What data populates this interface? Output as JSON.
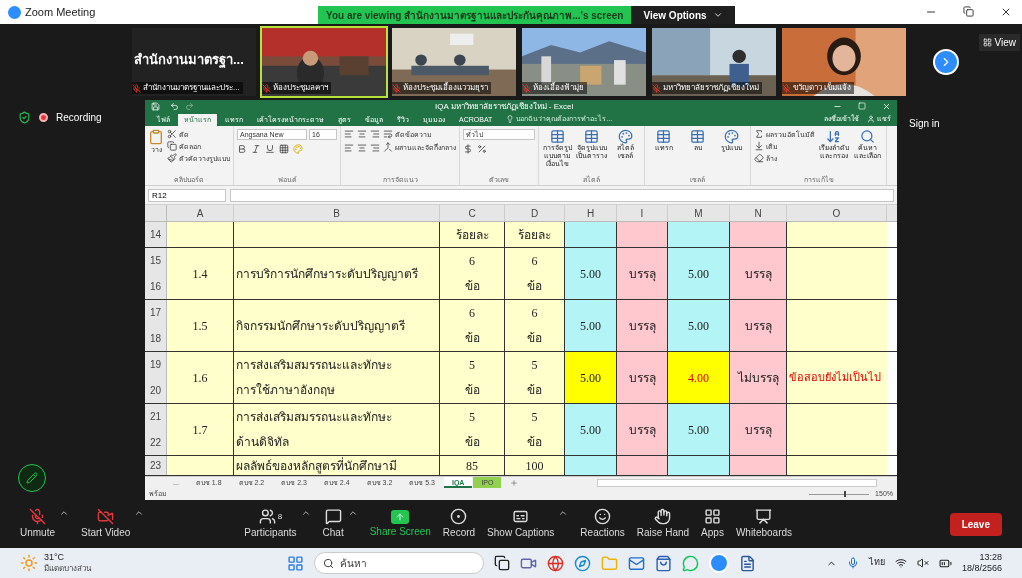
{
  "window": {
    "title": "Zoom Meeting"
  },
  "share_banner": {
    "text": "You are viewing สำนักงานมาตรฐานและประกันคุณภาพ...'s screen",
    "button": "View Options"
  },
  "view_button": "View",
  "recording": "Recording",
  "sign_in": "Sign in",
  "video_tiles": [
    {
      "kind": "text",
      "caption": "สำนักงานมาตรฐา...",
      "name": "สำนักงานมาตรฐานและประ...",
      "muted": true,
      "selected": false
    },
    {
      "kind": "picture",
      "name": "ห้องประชุมลคาฯ",
      "muted": true,
      "selected": true
    },
    {
      "kind": "picture",
      "name": "ห้องประชุมเอื้องแววมยุรา",
      "muted": true,
      "selected": false
    },
    {
      "kind": "picture",
      "name": "ห้องเอื้องฟ้ามุ่ย",
      "muted": true,
      "selected": false
    },
    {
      "kind": "picture",
      "name": "มหาวิทยาลัยราชภัฏเชียงใหม่",
      "muted": true,
      "selected": false
    },
    {
      "kind": "picture",
      "name": "ขวัญดาว เข็มแจ้ง",
      "muted": true,
      "selected": false
    }
  ],
  "excel": {
    "title": "IQA มหาวิทยาลัยราชภัฏเชียงใหม่ - Excel",
    "tabs": [
      {
        "label": "ไฟล์",
        "selected": false
      },
      {
        "label": "หน้าแรก",
        "selected": true
      },
      {
        "label": "แทรก",
        "selected": false
      },
      {
        "label": "เค้าโครงหน้ากระดาษ",
        "selected": false
      },
      {
        "label": "สูตร",
        "selected": false
      },
      {
        "label": "ข้อมูล",
        "selected": false
      },
      {
        "label": "รีวิว",
        "selected": false
      },
      {
        "label": "มุมมอง",
        "selected": false
      },
      {
        "label": "ACROBAT",
        "selected": false
      }
    ],
    "tell_me": "บอกฉันว่าคุณต้องการทำอะไร...",
    "sign_in": "ลงชื่อเข้าใช้",
    "share": "แชร์",
    "ribbon": [
      {
        "kind": "clipboard",
        "label": "คลิปบอร์ด",
        "big": "วาง",
        "small": [
          "ตัด",
          "คัดลอก",
          "ตัวคัดวางรูปแบบ"
        ]
      },
      {
        "kind": "font",
        "label": "ฟอนต์",
        "font": "Angsana New",
        "size": "16"
      },
      {
        "kind": "alignment",
        "label": "การจัดแนว",
        "small": [
          "ตัดข้อความ",
          "ผสานและจัดกึ่งกลาง"
        ]
      },
      {
        "kind": "number",
        "label": "ตัวเลข",
        "format": "ทั่วไป"
      },
      {
        "kind": "buttons",
        "label": "สไตล์",
        "buttons": [
          "การจัดรูปแบบตามเงื่อนไข",
          "จัดรูปแบบเป็นตาราง",
          "สไตล์เซลล์"
        ]
      },
      {
        "kind": "buttons",
        "label": "เซลล์",
        "buttons": [
          "แทรก",
          "ลบ",
          "รูปแบบ"
        ]
      },
      {
        "kind": "editing",
        "label": "การแก้ไข",
        "small": [
          "ผลรวมอัตโนมัติ",
          "เติม",
          "ล้าง"
        ],
        "buttons": [
          "เรียงลำดับและกรอง",
          "ค้นหาและเลือก"
        ]
      }
    ],
    "name_box": "R12",
    "columns": [
      "A",
      "B",
      "C",
      "D",
      "H",
      "I",
      "M",
      "N",
      "O"
    ],
    "records": [
      {
        "rows": [
          "14"
        ],
        "c": [
          "ร้อยละ"
        ],
        "d": [
          "ร้อยละ"
        ]
      },
      {
        "rows": [
          "15",
          "16"
        ],
        "no": "1.4",
        "topic": [
          "การบริการนักศึกษาระดับปริญญาตรี"
        ],
        "c": [
          "6",
          "ข้อ"
        ],
        "d": [
          "6",
          "ข้อ"
        ],
        "h": {
          "text": "5.00",
          "highlight": false,
          "flagged": false
        },
        "i": "บรรลุ",
        "m": {
          "text": "5.00",
          "highlight": false,
          "flagged": false
        },
        "n": "บรรลุ"
      },
      {
        "rows": [
          "17",
          "18"
        ],
        "no": "1.5",
        "topic": [
          "กิจกรรมนักศึกษาระดับปริญญาตรี"
        ],
        "c": [
          "6",
          "ข้อ"
        ],
        "d": [
          "6",
          "ข้อ"
        ],
        "h": {
          "text": "5.00",
          "highlight": false,
          "flagged": false
        },
        "i": "บรรลุ",
        "m": {
          "text": "5.00",
          "highlight": false,
          "flagged": false
        },
        "n": "บรรลุ"
      },
      {
        "rows": [
          "19",
          "20"
        ],
        "no": "1.6",
        "topic": [
          "การส่งเสริมสมรรถนะและทักษะ",
          "การใช้ภาษาอังกฤษ"
        ],
        "c": [
          "5",
          "ข้อ"
        ],
        "d": [
          "5",
          "ข้อ"
        ],
        "h": {
          "text": "5.00",
          "highlight": true
        },
        "i": "บรรลุ",
        "m": {
          "text": "4.00",
          "highlight": true,
          "flagged": true
        },
        "n": "ไม่บรรลุ",
        "o": "ข้อสอบยังไม่เป็นไป"
      },
      {
        "rows": [
          "21",
          "22"
        ],
        "no": "1.7",
        "topic": [
          "การส่งเสริมสมรรถนะและทักษะ",
          "ด้านดิจิทัล"
        ],
        "c": [
          "5",
          "ข้อ"
        ],
        "d": [
          "5",
          "ข้อ"
        ],
        "h": {
          "text": "5.00",
          "highlight": false,
          "flagged": false
        },
        "i": "บรรลุ",
        "m": {
          "text": "5.00",
          "highlight": false,
          "flagged": false
        },
        "n": "บรรลุ"
      },
      {
        "rows": [
          "23"
        ],
        "topic": [
          "ผลลัพธ์ของหลักสูตรที่นักศึกษามี"
        ],
        "c": [
          "85"
        ],
        "d": [
          "100"
        ]
      }
    ],
    "sheet_tabs": [
      {
        "label": "...",
        "selected": false
      },
      {
        "label": "ตบช 1.8",
        "selected": false
      },
      {
        "label": "ตบช 2.2",
        "selected": false
      },
      {
        "label": "ตบช 2.3",
        "selected": false
      },
      {
        "label": "ตบช 2.4",
        "selected": false
      },
      {
        "label": "ตบช 3.2",
        "selected": false
      },
      {
        "label": "ตบช 5.3",
        "selected": false
      },
      {
        "label": "IQA",
        "selected": true
      },
      {
        "label": "IPO",
        "selected": false,
        "color": "#92d050"
      }
    ],
    "status": "พร้อม",
    "zoom_slider": {
      "level": 0.6
    },
    "zoom": "150%"
  },
  "toolbar": [
    {
      "kind": "mic",
      "label": "Unmute",
      "off": true,
      "caret": true
    },
    {
      "kind": "video",
      "label": "Start Video",
      "off": true,
      "caret": true
    },
    {
      "kind": "participants",
      "label": "Participants",
      "badge": "8",
      "off": false,
      "caret": true
    },
    {
      "kind": "chat",
      "label": "Chat",
      "off": false,
      "caret": true
    },
    {
      "kind": "share",
      "label": "Share Screen",
      "off": false,
      "caret": false
    },
    {
      "kind": "record",
      "label": "Record",
      "off": false,
      "caret": false
    },
    {
      "kind": "captions",
      "label": "Show Captions",
      "off": false,
      "caret": true
    },
    {
      "kind": "reactions",
      "label": "Reactions",
      "off": false,
      "caret": false
    },
    {
      "kind": "hand",
      "label": "Raise Hand",
      "off": false,
      "caret": false
    },
    {
      "kind": "apps",
      "label": "Apps",
      "off": false,
      "caret": false
    },
    {
      "kind": "whiteboard",
      "label": "Whiteboards",
      "off": false,
      "caret": false
    }
  ],
  "leave": "Leave",
  "taskbar": {
    "temperature": "31°C",
    "weather": "มีแดดบางส่วน",
    "search": "ค้นหา",
    "language": "ไทย",
    "time": "13:28",
    "date": "18/8/2566"
  }
}
